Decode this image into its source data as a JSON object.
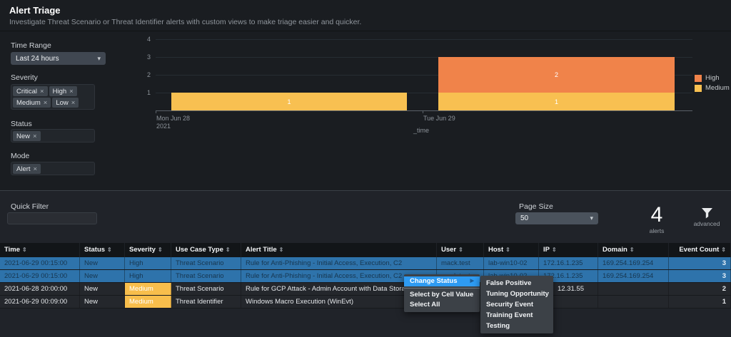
{
  "header": {
    "title": "Alert Triage",
    "subtitle": "Investigate Threat Scenario or Threat Identifier alerts with custom views to make triage easier and quicker."
  },
  "filters": {
    "time_range": {
      "label": "Time Range",
      "value": "Last 24 hours"
    },
    "severity": {
      "label": "Severity",
      "tags": [
        "Critical",
        "High",
        "Medium",
        "Low"
      ]
    },
    "status": {
      "label": "Status",
      "tags": [
        "New"
      ]
    },
    "mode": {
      "label": "Mode",
      "tags": [
        "Alert"
      ]
    }
  },
  "chart_data": {
    "type": "bar",
    "stacked": true,
    "x": [
      "Mon Jun 28 2021",
      "Tue Jun 29"
    ],
    "xticks": [
      [
        "Mon Jun 28",
        "2021"
      ],
      [
        "Tue Jun 29"
      ]
    ],
    "series": [
      {
        "name": "High",
        "color": "#f0834a",
        "values": [
          0,
          2
        ]
      },
      {
        "name": "Medium",
        "color": "#f8c051",
        "values": [
          1,
          1
        ]
      }
    ],
    "xlabel": "_time",
    "ylim": [
      0,
      4
    ],
    "yticks": [
      1,
      2,
      3,
      4
    ],
    "legend_position": "right",
    "grid": true
  },
  "toolbar": {
    "quick_filter_label": "Quick Filter",
    "quick_filter_value": "",
    "page_size_label": "Page Size",
    "page_size_value": "50",
    "alert_count": "4",
    "alert_count_label": "alerts",
    "advanced_label": "advanced"
  },
  "table": {
    "columns": [
      "Time",
      "Status",
      "Severity",
      "Use Case Type",
      "Alert Title",
      "User",
      "Host",
      "IP",
      "Domain",
      "Event Count"
    ],
    "sort_icon": "⇕",
    "rows": [
      {
        "time": "2021-06-29 00:15:00",
        "status": "New",
        "severity": "High",
        "use_case_type": "Threat Scenario",
        "alert_title": "Rule for Anti-Phishing - Initial Access, Execution, C2",
        "user": "mack.test",
        "host": "lab-win10-02",
        "ip": "172.16.1.235",
        "domain": "169.254.169.254",
        "event_count": "3",
        "selected": true
      },
      {
        "time": "2021-06-29 00:15:00",
        "status": "New",
        "severity": "High",
        "use_case_type": "Threat Scenario",
        "alert_title": "Rule for Anti-Phishing - Initial Access, Execution, C2",
        "user": "mack.test",
        "host": "lab-win10-02",
        "ip": "172.16.1.235",
        "domain": "169.254.169.254",
        "event_count": "3",
        "selected": true
      },
      {
        "time": "2021-06-28 20:00:00",
        "status": "New",
        "severity": "Medium",
        "use_case_type": "Threat Scenario",
        "alert_title": "Rule for GCP Attack - Admin Account with Data Storage",
        "user": "",
        "host": "",
        "ip": "12.31.55",
        "domain": "",
        "event_count": "2",
        "selected": false
      },
      {
        "time": "2021-06-29 00:09:00",
        "status": "New",
        "severity": "Medium",
        "use_case_type": "Threat Identifier",
        "alert_title": "Windows Macro Execution (WinEvt)",
        "user": "",
        "host": "",
        "ip": "",
        "domain": "",
        "event_count": "1",
        "selected": false
      }
    ]
  },
  "context_menu": {
    "items": [
      {
        "label": "Change Status",
        "highlighted": true,
        "has_submenu": true
      },
      {
        "label": "Select by Cell Value",
        "highlighted": false,
        "has_submenu": false
      },
      {
        "label": "Select All",
        "highlighted": false,
        "has_submenu": false
      }
    ],
    "submenu_items": [
      "False Positive",
      "Tuning Opportunity",
      "Security Event",
      "Training Event",
      "Testing"
    ]
  },
  "icons": {
    "caret": "▾",
    "submenu_arrow": "▶",
    "remove": "×"
  },
  "colors": {
    "selected_row": "#2e73ab",
    "selected_row_text": "#17364f",
    "severity_medium": "#f8be4c",
    "menu_highlight": "#2e9bf2"
  }
}
